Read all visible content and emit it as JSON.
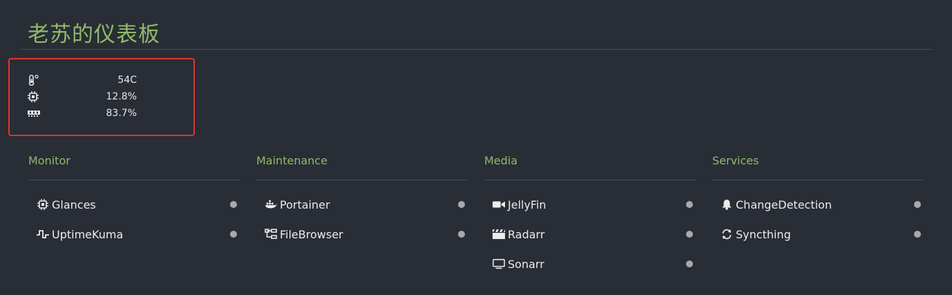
{
  "header": {
    "title": "老苏的仪表板"
  },
  "stats": [
    {
      "icon": "thermometer-icon",
      "value": "54C"
    },
    {
      "icon": "cpu-chip-icon",
      "value": "12.8%"
    },
    {
      "icon": "memory-icon",
      "value": "83.7%"
    }
  ],
  "groups": [
    {
      "title": "Monitor",
      "items": [
        {
          "icon": "chip-icon",
          "label": "Glances"
        },
        {
          "icon": "pulse-icon",
          "label": "UptimeKuma"
        }
      ]
    },
    {
      "title": "Maintenance",
      "items": [
        {
          "icon": "docker-icon",
          "label": "Portainer"
        },
        {
          "icon": "folder-tree-icon",
          "label": "FileBrowser"
        }
      ]
    },
    {
      "title": "Media",
      "items": [
        {
          "icon": "video-camera-icon",
          "label": "JellyFin"
        },
        {
          "icon": "clapperboard-icon",
          "label": "Radarr"
        },
        {
          "icon": "monitor-icon",
          "label": "Sonarr"
        }
      ]
    },
    {
      "title": "Services",
      "items": [
        {
          "icon": "bell-icon",
          "label": "ChangeDetection"
        },
        {
          "icon": "sync-icon",
          "label": "Syncthing"
        }
      ]
    }
  ],
  "colors": {
    "background": "#292d35",
    "accent": "#8fba6a",
    "highlight_border": "#e0352b",
    "status_dot": "#a9a9a9"
  }
}
